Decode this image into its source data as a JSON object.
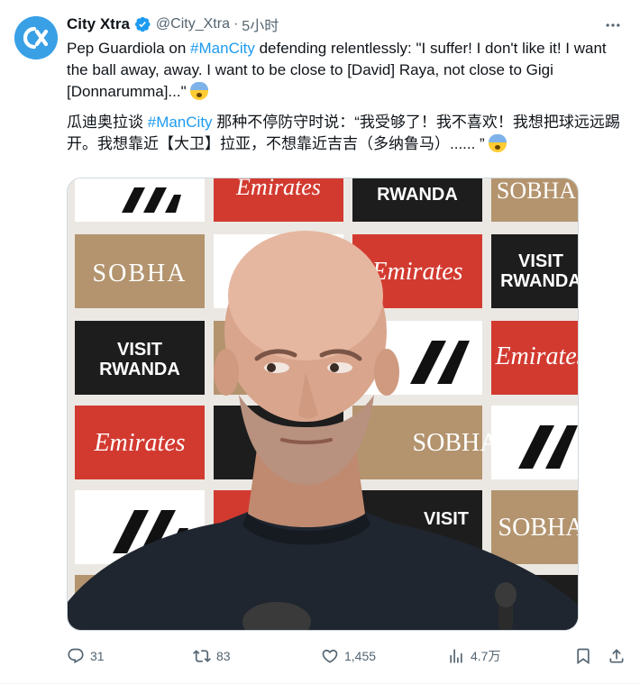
{
  "author": {
    "name": "City Xtra",
    "handle": "@City_Xtra",
    "separator": "·",
    "time": "5小时",
    "verified": true,
    "avatar_icon": "city-xtra-logo-icon"
  },
  "tweet": {
    "english": {
      "before": "Pep Guardiola on ",
      "hashtag": "#ManCity",
      "after": " defending relentlessly: \"I suffer! I don't like it! I want the ball away, away. I want to be close to [David] Raya, not close to Gigi [Donnarumma]...\""
    },
    "chinese": {
      "before": "瓜迪奥拉谈 ",
      "hashtag": "#ManCity",
      "after": " 那种不停防守时说：“我受够了！我不喜欢！我想把球远远踢开。我想靠近【大卫】拉亚，不想靠近吉吉（多纳鲁马）...... ”"
    },
    "emoji": "anxious-face-emoji"
  },
  "media": {
    "alt": "Pep Guardiola at a press conference in front of a sponsor backdrop",
    "sponsor_labels": [
      "SOBHA",
      "Emirates",
      "VISIT",
      "RWANDA"
    ]
  },
  "actions": {
    "reply_count": "31",
    "retweet_count": "83",
    "like_count": "1,455",
    "views_count": "4.7万"
  },
  "colors": {
    "accent": "#1d9bf0",
    "text": "#0f1419",
    "secondary": "#536471"
  }
}
